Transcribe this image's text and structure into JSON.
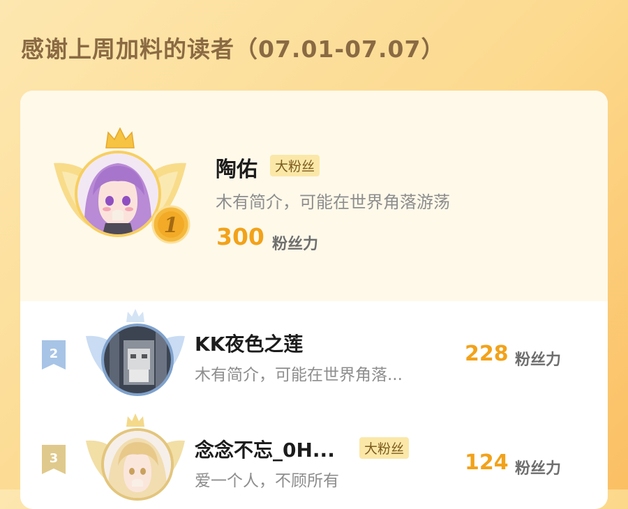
{
  "header": {
    "title": "感谢上周加料的读者（07.01-07.07）"
  },
  "colors": {
    "accent_orange": "#f2a21a",
    "badge_bg": "#fbe8a8",
    "panel_bg": "#fff9ea",
    "title_brown": "#8a6a43"
  },
  "readers": [
    {
      "rank": "1",
      "name": "陶佑",
      "badge": "大粉丝",
      "bio": "木有简介，可能在世界角落游荡",
      "score": "300",
      "score_unit": "粉丝力"
    },
    {
      "rank": "2",
      "name": "KK夜色之莲",
      "badge": "",
      "bio": "木有简介，可能在世界角落...",
      "score": "228",
      "score_unit": "粉丝力"
    },
    {
      "rank": "3",
      "name": "念念不忘_0H...",
      "badge": "大粉丝",
      "bio": "爱一个人，不顾所有",
      "score": "124",
      "score_unit": "粉丝力"
    }
  ]
}
